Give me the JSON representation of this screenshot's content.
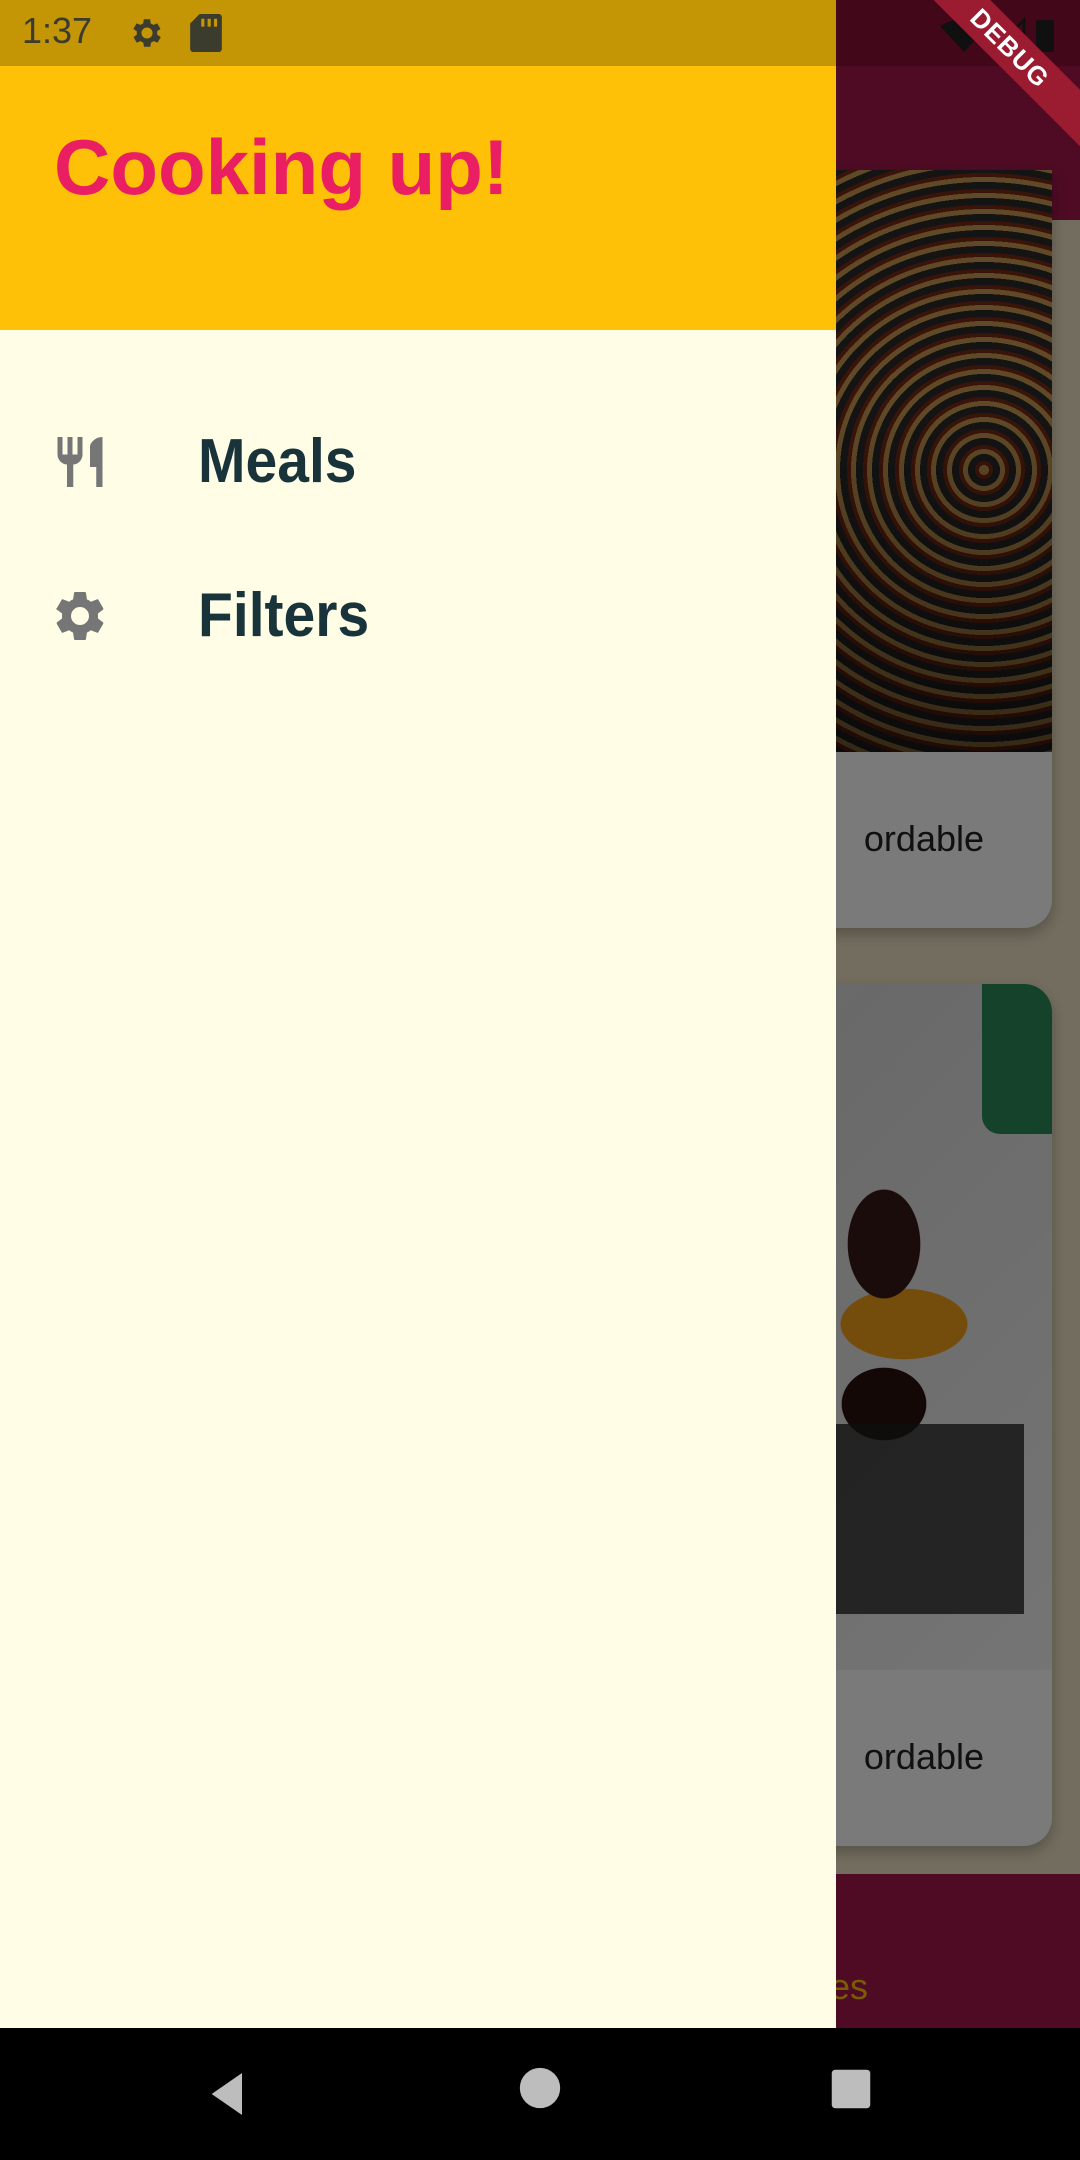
{
  "status_bar": {
    "time": "1:37",
    "icons": [
      "gear-icon",
      "sd-card-icon",
      "wifi-icon",
      "signal-icon",
      "battery-icon"
    ]
  },
  "debug_banner": "DEBUG",
  "drawer": {
    "title": "Cooking up!",
    "items": [
      {
        "label": "Meals",
        "icon": "restaurant-icon"
      },
      {
        "label": "Filters",
        "icon": "settings-icon"
      }
    ]
  },
  "background_app": {
    "cards": [
      {
        "meta_text": "ordable"
      },
      {
        "meta_text": "ordable"
      }
    ],
    "bottom_tab_partial": "tes"
  },
  "colors": {
    "drawer_header": "#ffc107",
    "drawer_title": "#e91e63",
    "drawer_background": "#fffde6",
    "item_text": "#18343a",
    "app_bar": "#a3184a"
  },
  "navigation_bar": {
    "buttons": [
      "back-icon",
      "home-icon",
      "recents-icon"
    ]
  }
}
